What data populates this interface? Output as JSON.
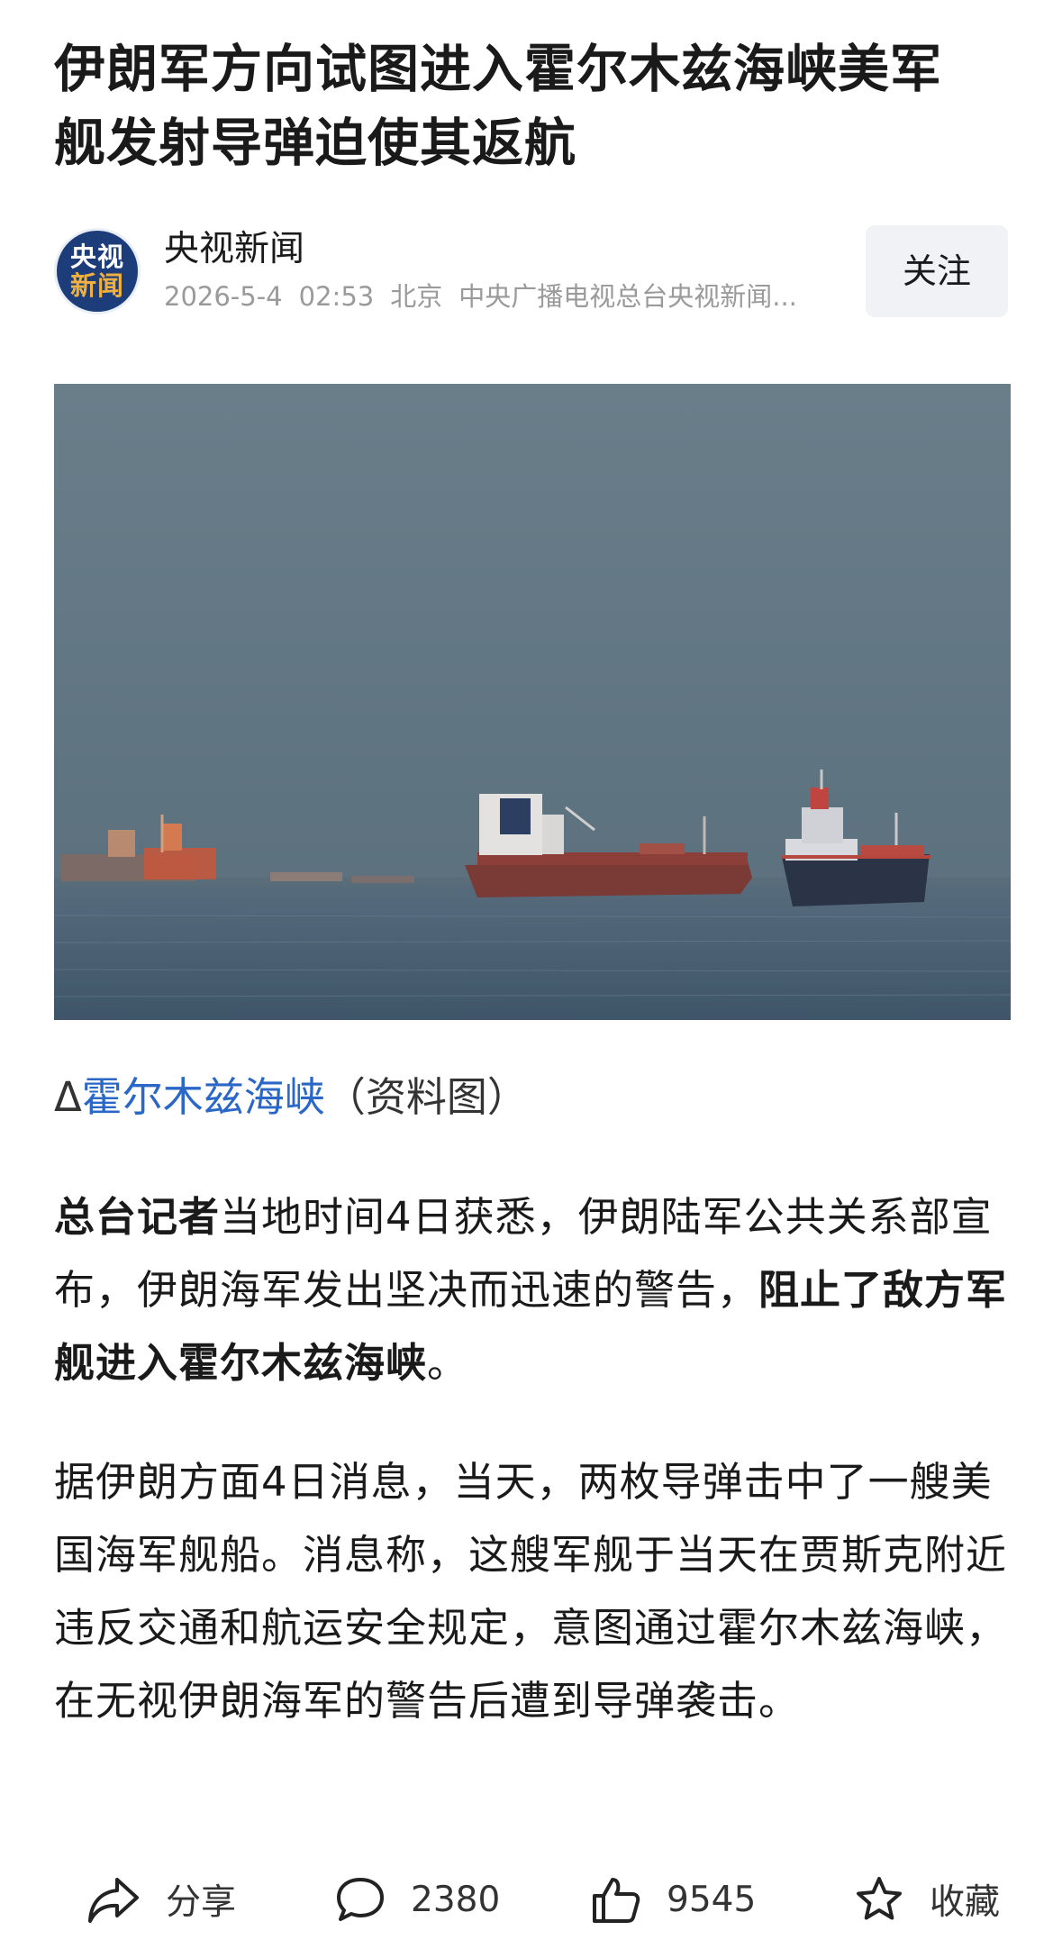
{
  "article": {
    "title": "伊朗军方向试图进入霍尔木兹海峡美军舰发射导弹迫使其返航"
  },
  "author": {
    "logo_text_top": "央视",
    "logo_text_bottom": "新闻",
    "name": "央视新闻",
    "date": "2026-5-4",
    "time": "02:53",
    "location": "北京",
    "source": "中央广播电视总台央视新闻...",
    "follow_label": "关注"
  },
  "image": {
    "icon": "ships-at-sea-photo"
  },
  "caption": {
    "prefix": "Δ",
    "link": "霍尔木兹海峡",
    "suffix": "（资料图）"
  },
  "body": {
    "p1_bold": "总台记者",
    "p1_text": "当地时间4日获悉，伊朗陆军公共关系部宣布，伊朗海军发出坚决而迅速的警告，",
    "p1_bold2": "阻止了敌方军舰进入霍尔木兹海峡",
    "p1_end": "。",
    "p2": "据伊朗方面4日消息，当天，两枚导弹击中了一艘美国海军舰船。消息称，这艘军舰于当天在贾斯克附近违反交通和航运安全规定，意图通过霍尔木兹海峡，在无视伊朗海军的警告后遭到导弹袭击。"
  },
  "actions": {
    "share_label": "分享",
    "comment_count": "2380",
    "like_count": "9545",
    "favorite_label": "收藏"
  }
}
